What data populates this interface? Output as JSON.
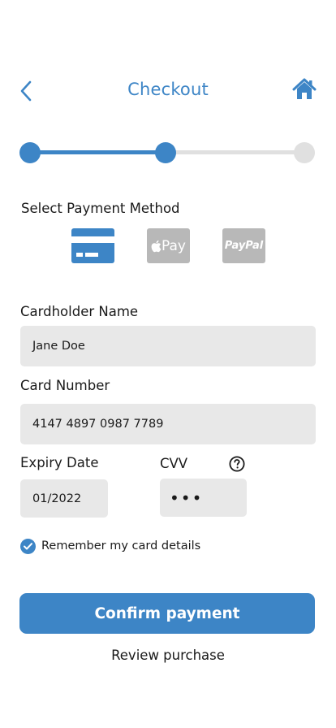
{
  "header": {
    "title": "Checkout",
    "back_icon": "chevron-left-icon",
    "home_icon": "home-icon"
  },
  "progress": {
    "steps_total": 3,
    "current_step": 2
  },
  "payment": {
    "section_label": "Select Payment Method",
    "methods": [
      {
        "name": "card",
        "icon": "credit-card-icon",
        "selected": true,
        "label": ""
      },
      {
        "name": "apple-pay",
        "icon": "apple-pay-icon",
        "selected": false,
        "label": "Pay"
      },
      {
        "name": "paypal",
        "icon": "paypal-icon",
        "selected": false,
        "label": "PayPal"
      }
    ]
  },
  "form": {
    "cardholder_label": "Cardholder Name",
    "cardholder_value": "Jane Doe",
    "card_number_label": "Card Number",
    "card_number_value": "4147 4897 0987 7789",
    "expiry_label": "Expiry Date",
    "expiry_value": "01/2022",
    "cvv_label": "CVV",
    "cvv_value": "•••",
    "remember_label": "Remember my card details",
    "remember_checked": true
  },
  "actions": {
    "confirm_label": "Confirm payment",
    "review_label": "Review purchase"
  },
  "colors": {
    "accent": "#3d85c6",
    "field_bg": "#e8e8e8",
    "inactive": "#b8b8b8",
    "track_inactive": "#e0e0e0"
  }
}
